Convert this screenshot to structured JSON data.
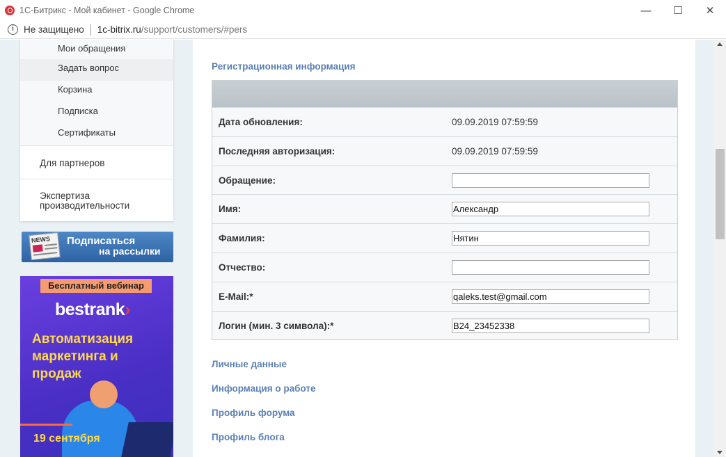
{
  "window": {
    "title": "1С-Битрикс - Мой кабинет - Google Chrome",
    "minimize": "—",
    "maximize": "☐",
    "close": "✕"
  },
  "address": {
    "security": "Не защищено",
    "host": "1c-bitrix.ru",
    "path": "/support/customers/#pers"
  },
  "sidebar": {
    "subitems": [
      {
        "label": "Мои обращения"
      },
      {
        "label": "Задать вопрос"
      },
      {
        "label": "Корзина"
      },
      {
        "label": "Подписка"
      },
      {
        "label": "Сертификаты"
      }
    ],
    "partners": "Для партнеров",
    "expertise_line1": "Экспертиза",
    "expertise_line2": "производительности",
    "news_banner": {
      "icon_word": "NEWS",
      "line1": "Подписаться",
      "line2": "на рассылки"
    },
    "webinar": {
      "badge": "Бесплатный вебинар",
      "brand_a": "best",
      "brand_b": "rank",
      "brand_mark": "›",
      "line1": "Автоматизация",
      "line2": "маркетинга и",
      "line3": "продаж",
      "date": "19 сентября"
    }
  },
  "main": {
    "reg_title": "Регистрационная информация",
    "rows": [
      {
        "label": "Дата обновления:",
        "value": "09.09.2019 07:59:59"
      },
      {
        "label": "Последняя авторизация:",
        "value": "09.09.2019 07:59:59"
      },
      {
        "label": "Обращение:",
        "input": ""
      },
      {
        "label": "Имя:",
        "input": "Александр"
      },
      {
        "label": "Фамилия:",
        "input": "Нятин"
      },
      {
        "label": "Отчество:",
        "input": ""
      },
      {
        "label": "E-Mail:*",
        "input": "qaleks.test@gmail.com"
      },
      {
        "label": "Логин (мин. 3 символа):*",
        "input": "B24_23452338"
      }
    ],
    "links": {
      "personal": "Личные данные",
      "work": "Информация о работе",
      "forum": "Профиль форума",
      "blog": "Профиль блога"
    }
  }
}
